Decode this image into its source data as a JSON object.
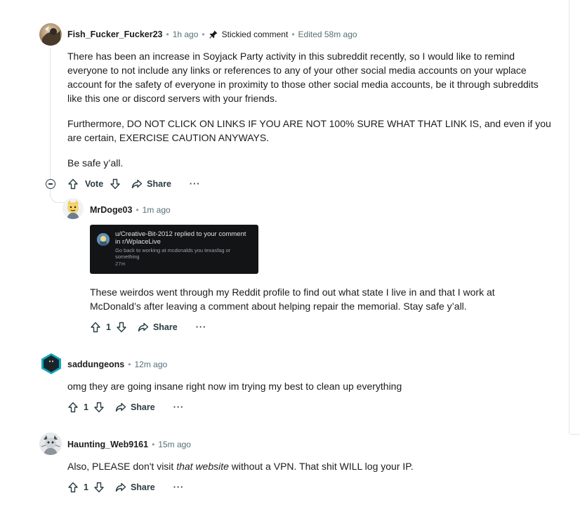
{
  "comments": [
    {
      "author": "Fish_Fucker_Fucker23",
      "time": "1h ago",
      "stickied": "Stickied comment",
      "edited": "Edited 58m ago",
      "paragraphs": [
        "There has been an increase in Soyjack Party activity in this subreddit recently, so I would like to remind everyone to not include any links or references to any of your other social media accounts on your wplace account for the safety of everyone in proximity to those other social media accounts, be it through subreddits like this one or discord servers with your friends.",
        "Furthermore, DO NOT CLICK ON LINKS IF YOU ARE NOT 100% SURE WHAT THAT LINK IS, and even if you are certain, EXERCISE CAUTION ANYWAYS.",
        "Be safe y’all."
      ],
      "vote_label": "Vote",
      "share_label": "Share",
      "more_label": "···"
    },
    {
      "author": "MrDoge03",
      "time": "1m ago",
      "embedded_notification": {
        "title": "u/Creative-Bit-2012 replied to your comment in r/WplaceLive",
        "body": "Go back to working at mcdonalds you texasfag or something",
        "time": "27m"
      },
      "text": "These weirdos went through my Reddit profile to find out what state I live in and that I work at McDonald’s after leaving a comment about helping repair the memorial. Stay safe y’all.",
      "votes": "1",
      "share_label": "Share",
      "more_label": "···"
    },
    {
      "author": "saddungeons",
      "time": "12m ago",
      "text": "omg they are going insane right now im trying my best to clean up everything",
      "votes": "1",
      "share_label": "Share",
      "more_label": "···"
    },
    {
      "author": "Haunting_Web9161",
      "time": "15m ago",
      "text_before": "Also, PLEASE don't visit ",
      "text_italic": "that website",
      "text_after": " without a VPN. That shit WILL log your IP.",
      "votes": "1",
      "share_label": "Share",
      "more_label": "···"
    }
  ],
  "separator": "•",
  "icons": {
    "pin": "pin-icon",
    "upvote": "upvote-arrow-icon",
    "downvote": "downvote-arrow-icon",
    "share": "share-arrow-icon",
    "collapse": "collapse-minus-icon"
  },
  "colors": {
    "text": "#1c1c1c",
    "meta": "#576f76",
    "thread_line": "#e0e3e5",
    "notification_bg": "#121416"
  }
}
